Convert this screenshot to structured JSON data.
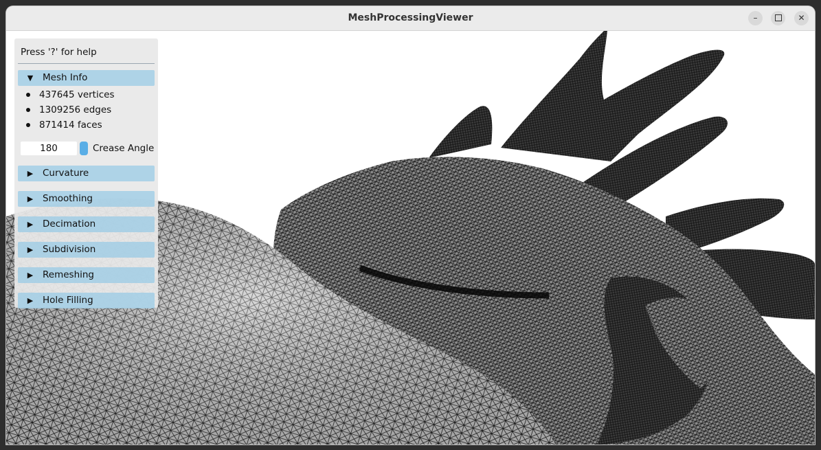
{
  "window": {
    "title": "MeshProcessingViewer",
    "controls": {
      "minimize_icon": "minimize-icon",
      "maximize_icon": "maximize-icon",
      "close_icon": "close-icon"
    }
  },
  "panel": {
    "help_text": "Press '?' for help",
    "mesh_info": {
      "label": "Mesh Info",
      "expanded": true,
      "stats": [
        "437645 vertices",
        "1309256 edges",
        "871414 faces"
      ],
      "crease_angle_value": "180",
      "crease_angle_label": "Crease Angle"
    },
    "sections": [
      {
        "label": "Curvature",
        "expanded": false
      },
      {
        "label": "Smoothing",
        "expanded": false
      },
      {
        "label": "Decimation",
        "expanded": false
      },
      {
        "label": "Subdivision",
        "expanded": false
      },
      {
        "label": "Remeshing",
        "expanded": false
      },
      {
        "label": "Hole Filling",
        "expanded": false
      }
    ]
  },
  "colors": {
    "header_bg": "#9ccce6",
    "slider": "#5aaee6",
    "mesh_fill": "#bdbdbd",
    "wire": "#1a1a1a"
  }
}
